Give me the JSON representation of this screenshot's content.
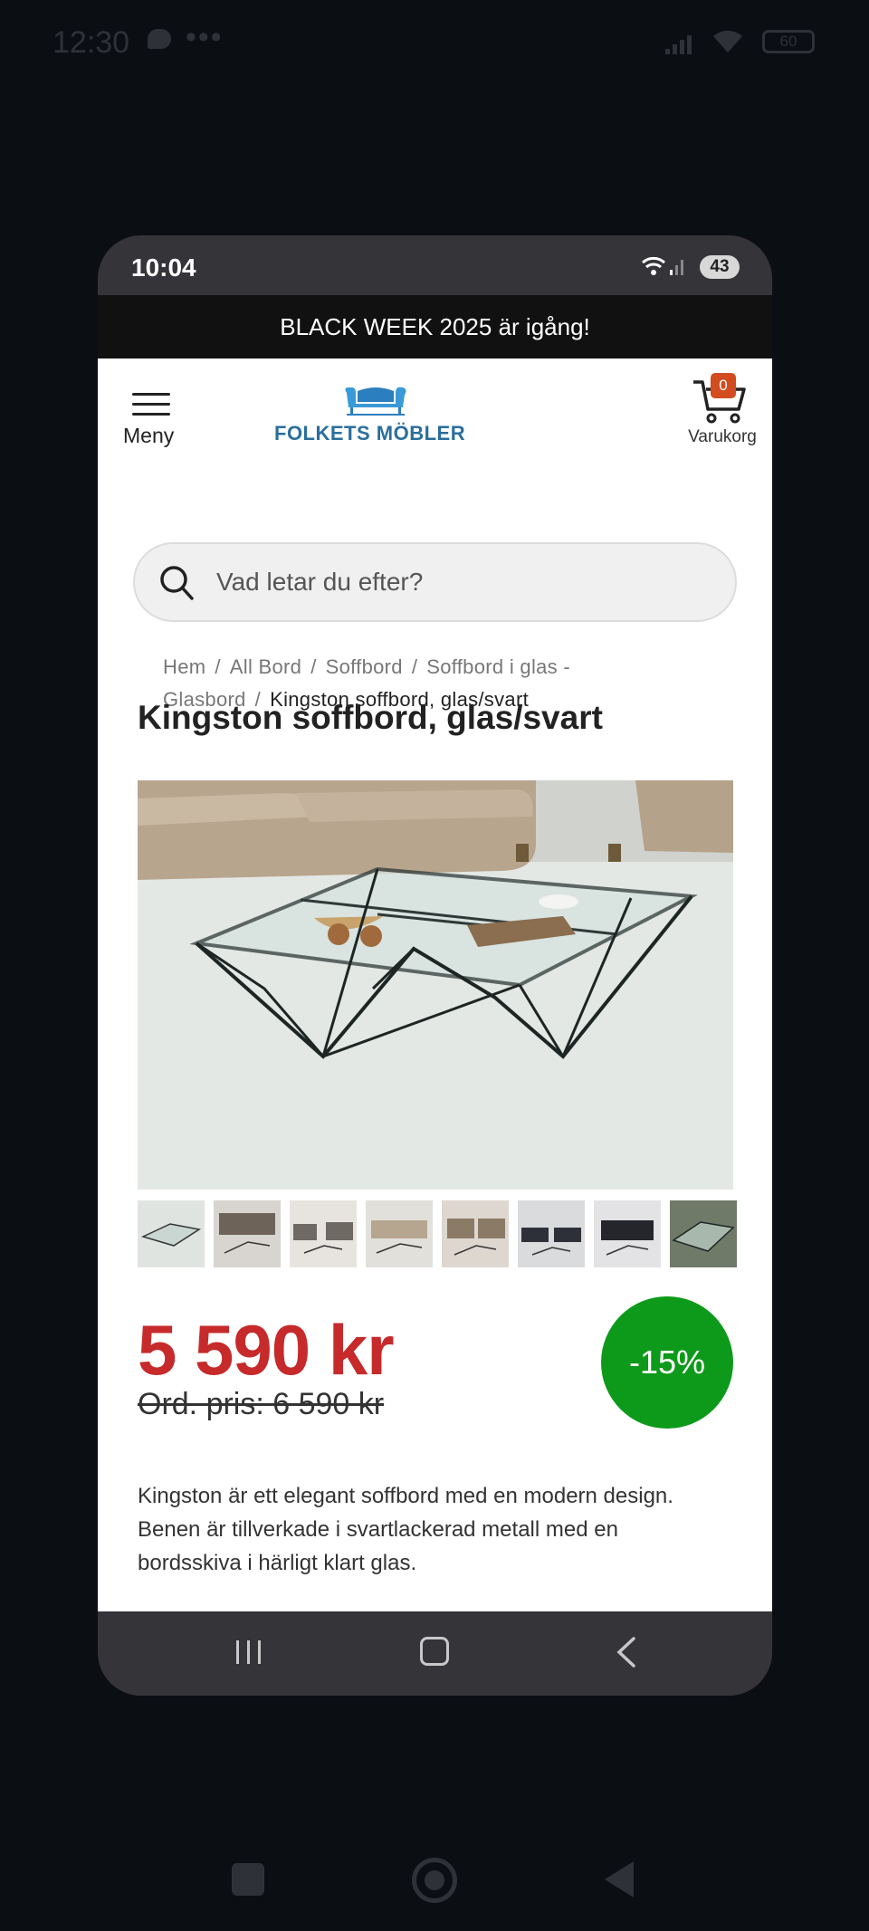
{
  "outer_status": {
    "time": "12:30",
    "dots": "•••",
    "battery": "60"
  },
  "phone_status": {
    "time": "10:04",
    "battery": "43"
  },
  "promo_banner": "BLACK WEEK 2025 är igång!",
  "header": {
    "menu_label": "Meny",
    "logo_text": "FOLKETS MÖBLER",
    "cart_count": "0",
    "cart_label": "Varukorg"
  },
  "search": {
    "placeholder": "Vad letar du efter?",
    "icon": "search-icon"
  },
  "breadcrumb": {
    "items": [
      "Hem",
      "All Bord",
      "Soffbord",
      "Soffbord i glas - Glasbord"
    ],
    "current": "Kingston soffbord, glas/svart",
    "separator": "/"
  },
  "product": {
    "title": "Kingston soffbord, glas/svart",
    "price": "5 590 kr",
    "old_price": "Ord. pris: 6 590 kr",
    "discount": "-15%",
    "description": "Kingston är ett elegant soffbord med en modern design. Benen är tillverkade i svartlackerad metall med en bordsskiva i härligt klart glas.",
    "thumbnail_count": 8
  },
  "colors": {
    "price": "#c62a2a",
    "discount_badge": "#0d9a1a",
    "logo": "#2b6e9c",
    "cart_badge": "#d24c1f",
    "promo_bg": "#111111"
  }
}
